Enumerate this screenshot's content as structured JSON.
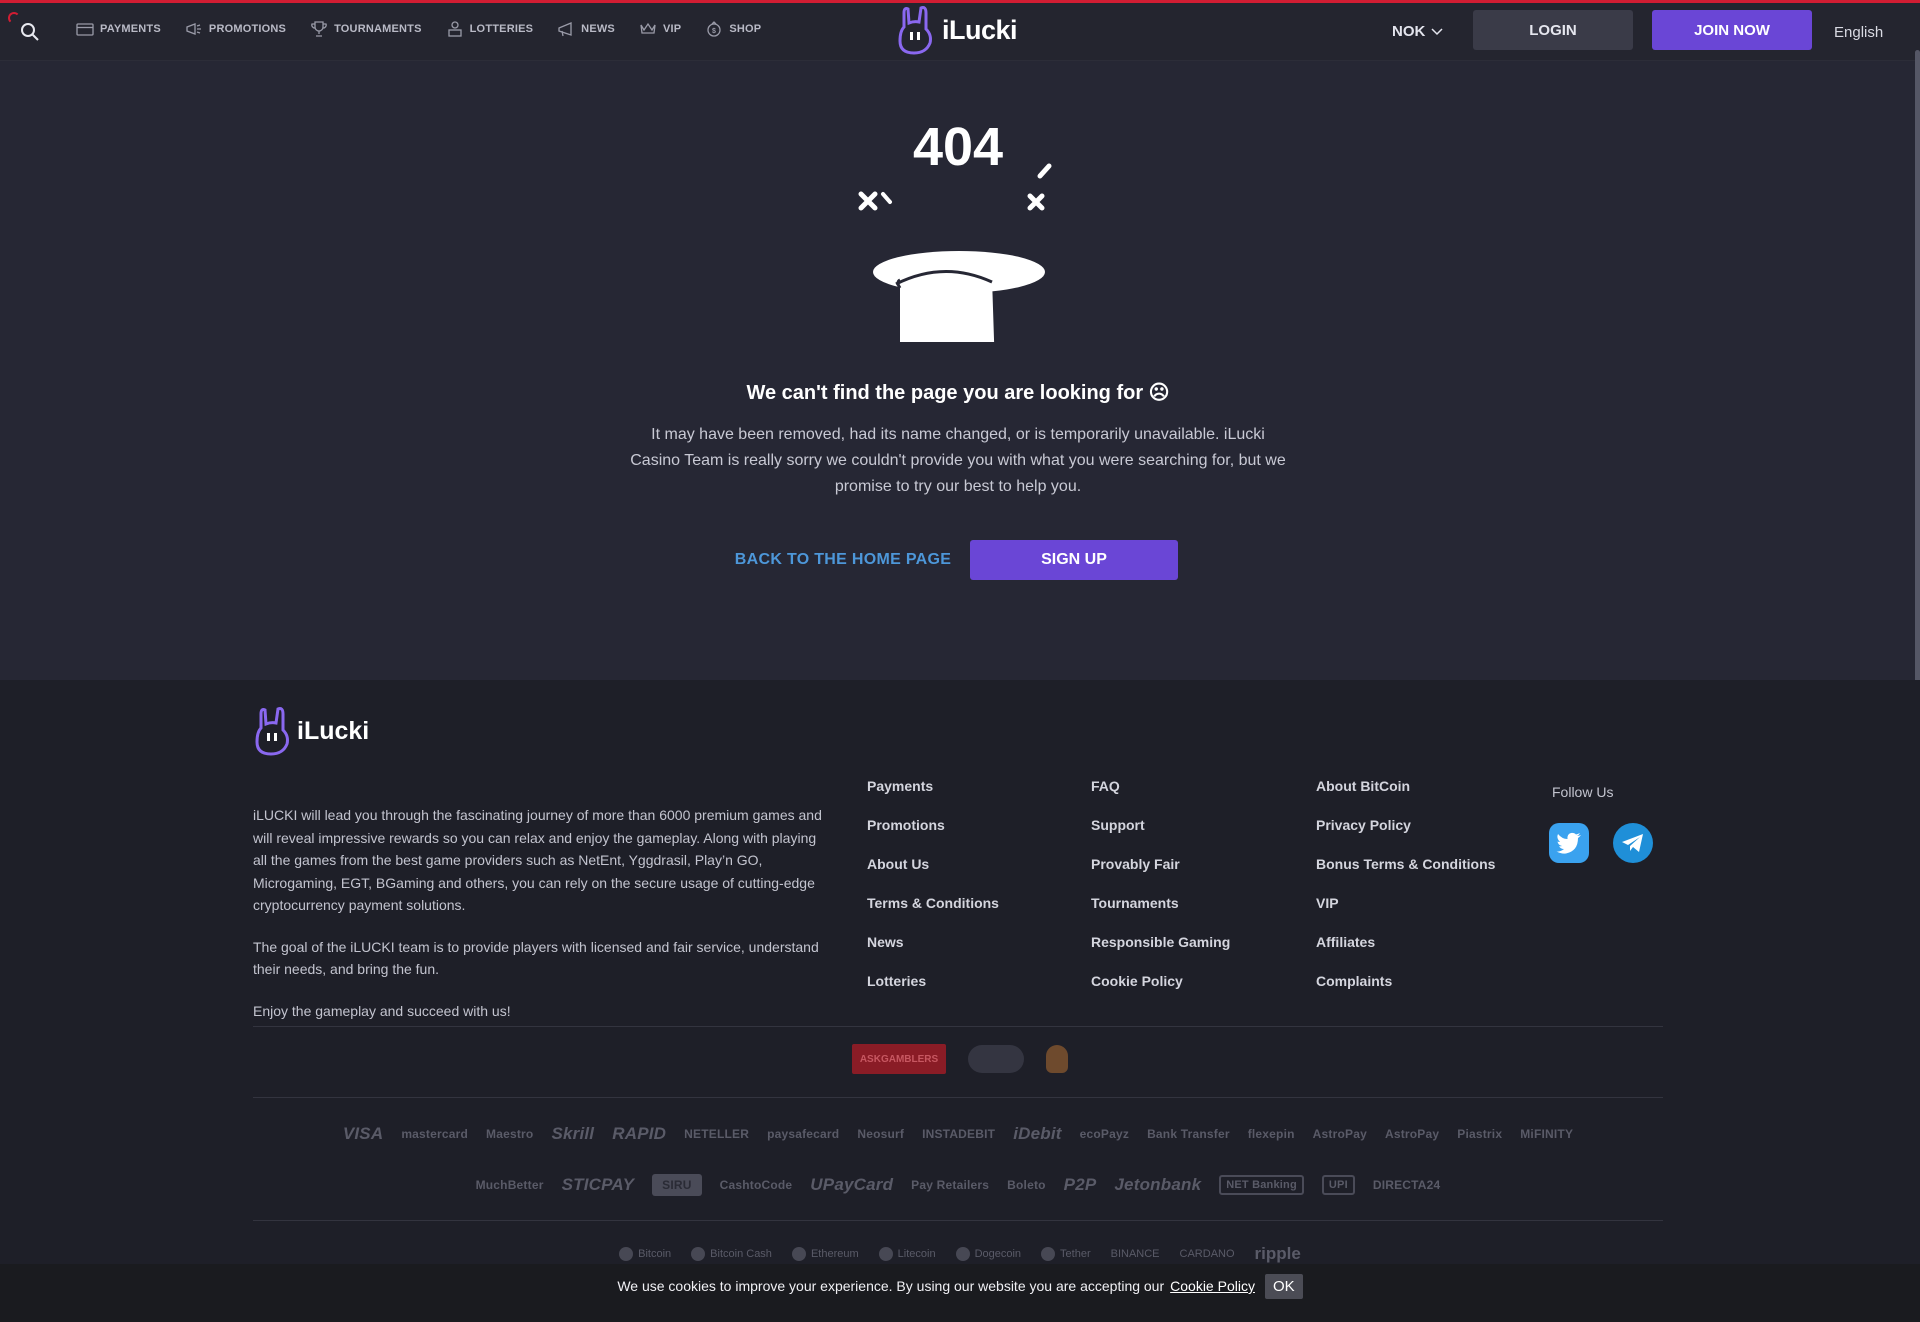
{
  "header": {
    "nav": [
      {
        "label": "PAYMENTS",
        "icon": "card-icon"
      },
      {
        "label": "PROMOTIONS",
        "icon": "megaphone-icon"
      },
      {
        "label": "TOURNAMENTS",
        "icon": "trophy-icon"
      },
      {
        "label": "LOTTERIES",
        "icon": "lottery-icon"
      },
      {
        "label": "NEWS",
        "icon": "news-icon"
      },
      {
        "label": "VIP",
        "icon": "crown-icon"
      },
      {
        "label": "SHOP",
        "icon": "shop-icon"
      }
    ],
    "logo_text": "iLucki",
    "currency": "NOK",
    "login_label": "LOGIN",
    "join_label": "JOIN NOW",
    "language": "English"
  },
  "error": {
    "code": "404",
    "title": "We can't find the page you are looking for ☹",
    "message": "It may have been removed, had its name changed, or is temporarily unavailable. iLucki Casino Team is really sorry we couldn't provide you with what you were searching for, but we promise to try our best to help you.",
    "home_link": "BACK TO THE HOME PAGE",
    "signup_label": "SIGN UP"
  },
  "footer": {
    "logo_text": "iLucki",
    "about": [
      "iLUCKI will lead you through the fascinating journey of more than 6000 premium games and will reveal impressive rewards so you can relax and enjoy the gameplay. Along with playing all the games from the best game providers such as NetEnt, Yggdrasil, Play’n GO, Microgaming, EGT, BGaming and others, you can rely on the secure usage of cutting-edge cryptocurrency payment solutions.",
      "The goal of the iLUCKI team is to provide players with licensed and fair service, understand their needs, and bring the fun.",
      "Enjoy the gameplay and succeed with us!"
    ],
    "col1": [
      "Payments",
      "Promotions",
      "About Us",
      "Terms & Conditions",
      "News",
      "Lotteries"
    ],
    "col2": [
      "FAQ",
      "Support",
      "Provably Fair",
      "Tournaments",
      "Responsible Gaming",
      "Cookie Policy"
    ],
    "col3": [
      "About BitCoin",
      "Privacy Policy",
      "Bonus Terms & Conditions",
      "VIP",
      "Affiliates",
      "Complaints"
    ],
    "follow_label": "Follow Us",
    "badges": {
      "askgamblers": "ASKGAMBLERS"
    },
    "payments_row1": [
      "VISA",
      "mastercard",
      "Maestro",
      "Skrill",
      "RAPID",
      "NETELLER",
      "paysafecard",
      "Neosurf",
      "INSTADEBIT",
      "iDebit",
      "ecoPayz",
      "Bank Transfer",
      "flexepin",
      "AstroPay",
      "AstroPay",
      "Piastrix",
      "MiFINITY"
    ],
    "payments_row2": [
      "MuchBetter",
      "STICPAY",
      "CashtoCode",
      "UPayCard",
      "Pay Retailers",
      "Boleto",
      "P2P",
      "Jetonbank",
      "NET Banking",
      "UPI",
      "DIRECTA24"
    ],
    "crypto": [
      "Bitcoin",
      "Bitcoin Cash",
      "Ethereum",
      "Litecoin",
      "Dogecoin",
      "Tether",
      "BINANCE",
      "CARDANO",
      "ripple"
    ]
  },
  "cookie": {
    "text": "We use cookies to improve your experience. By using our website you are accepting our",
    "link": "Cookie Policy",
    "ok": "OK"
  },
  "colors": {
    "accent": "#6a46d6",
    "link": "#4d97d9",
    "twitter": "#3aa2ef",
    "telegram": "#1f8fd8"
  }
}
